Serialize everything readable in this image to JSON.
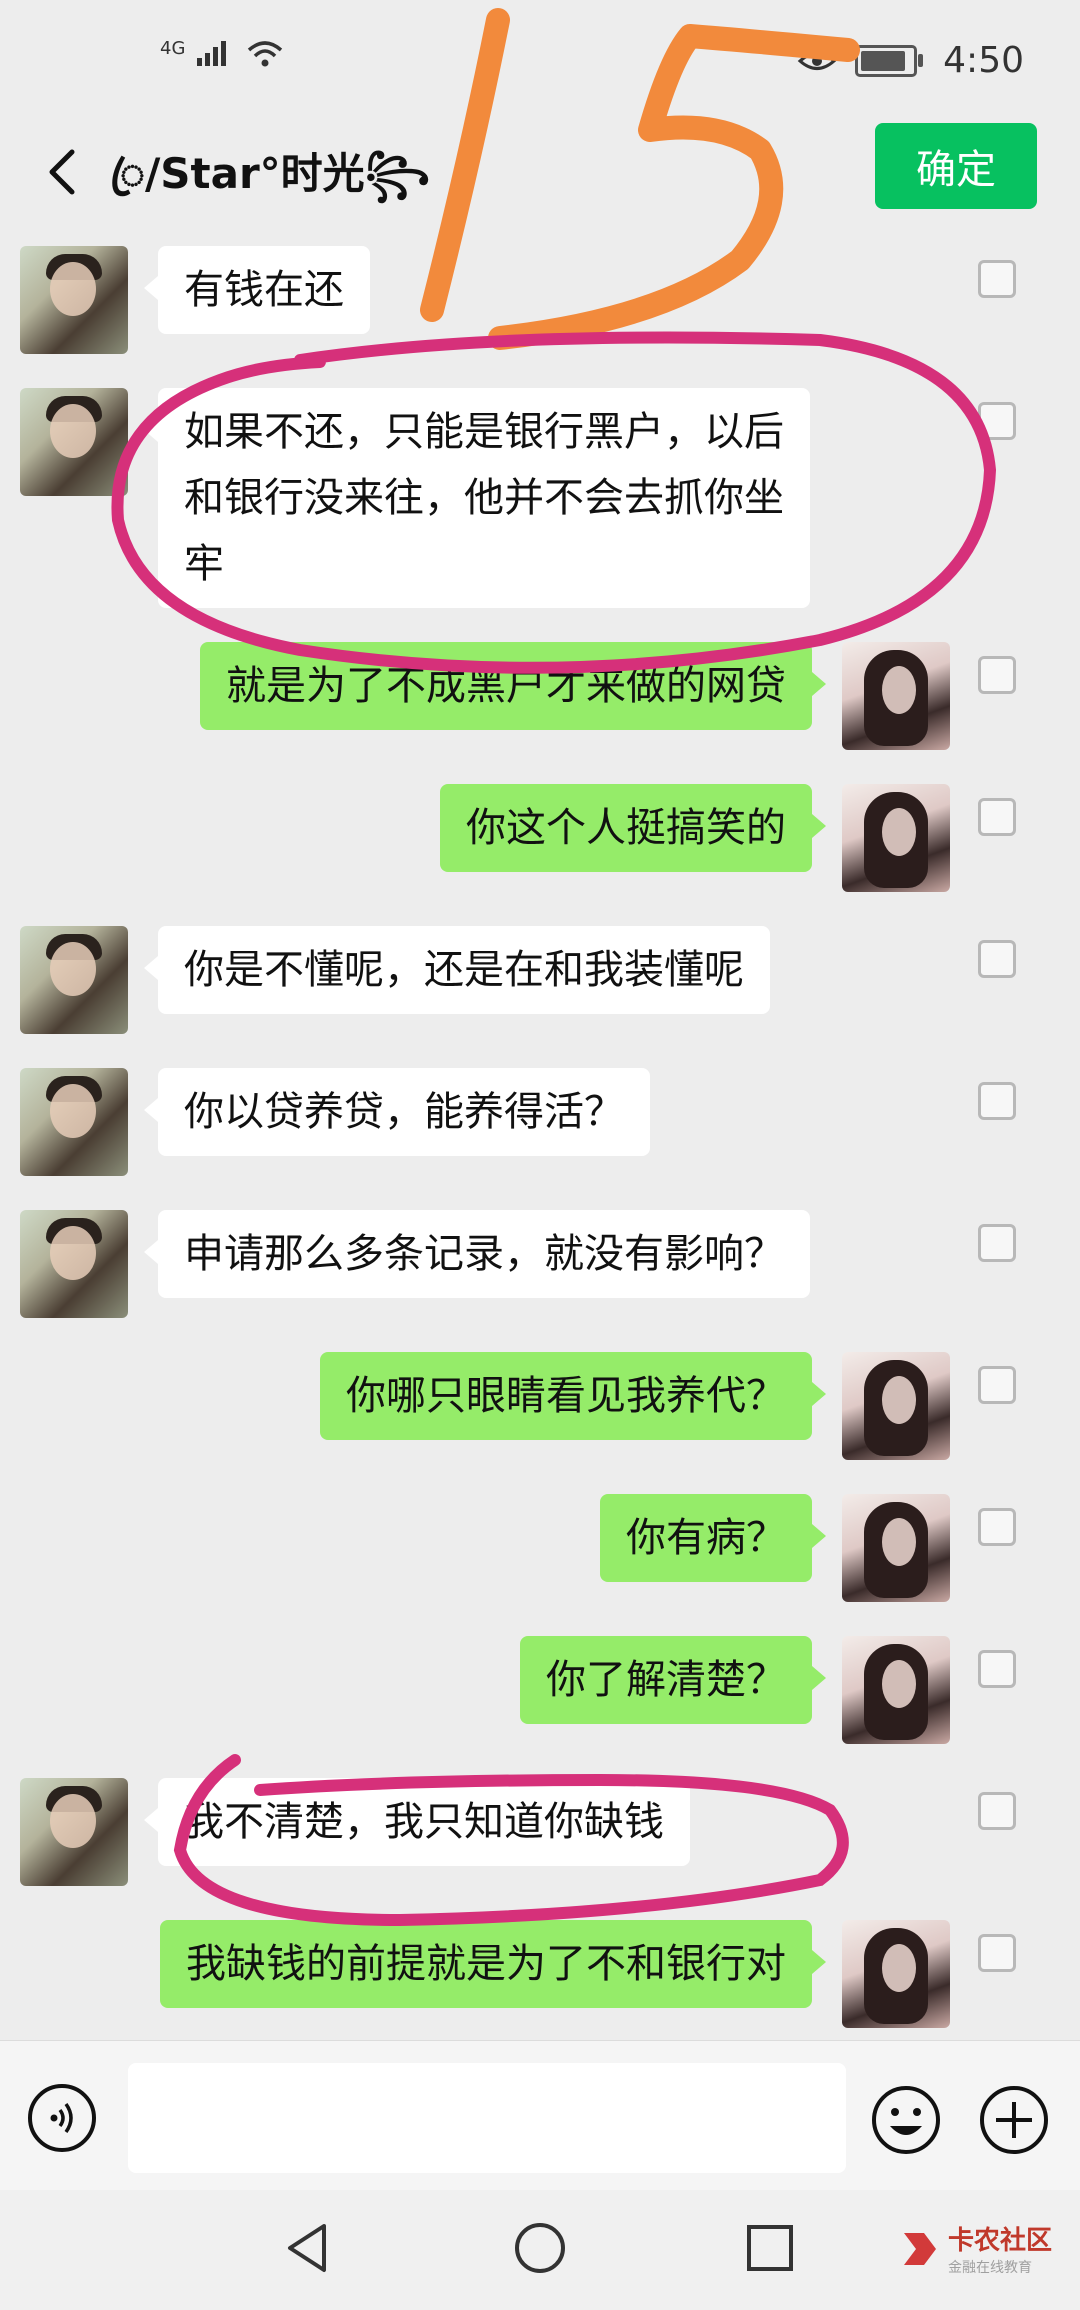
{
  "status_bar": {
    "network": "4G",
    "time": "4:50"
  },
  "header": {
    "contact_name": "ꦿ/Star°时光꧂",
    "confirm_label": "确定"
  },
  "messages": [
    {
      "side": "in",
      "text": "有钱在还"
    },
    {
      "side": "in",
      "text": "如果不还，只能是银行黑户，以后\n和银行没来往，他并不会去抓你坐\n牢"
    },
    {
      "side": "out",
      "text": "就是为了不成黑户才来做的网贷"
    },
    {
      "side": "out",
      "text": "你这个人挺搞笑的"
    },
    {
      "side": "in",
      "text": "你是不懂呢，还是在和我装懂呢"
    },
    {
      "side": "in",
      "text": "你以贷养贷，能养得活？"
    },
    {
      "side": "in",
      "text": "申请那么多条记录，就没有影响？"
    },
    {
      "side": "out",
      "text": "你哪只眼睛看见我养代？"
    },
    {
      "side": "out",
      "text": "你有病？"
    },
    {
      "side": "out",
      "text": "你了解清楚？"
    },
    {
      "side": "in",
      "text": "我不清楚，我只知道你缺钱"
    },
    {
      "side": "out",
      "text": "我缺钱的前提就是为了不和银行对"
    }
  ],
  "handwritten_annotation": "15",
  "annotation_colors": {
    "number": "#f28a3c",
    "circle": "#d6307a"
  },
  "watermark": {
    "brand": "卡农社区",
    "tagline": "金融在线教育"
  },
  "colors": {
    "accent_green": "#07c160",
    "outgoing_bubble": "#95ec69",
    "incoming_bubble": "#ffffff"
  }
}
